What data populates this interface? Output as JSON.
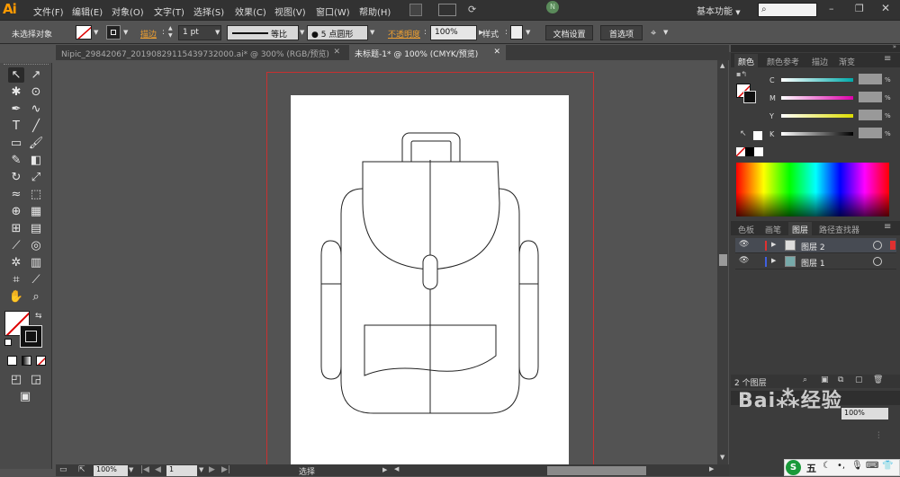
{
  "app": {
    "logo": "Ai",
    "workspace": "基本功能"
  },
  "menu": [
    "文件(F)",
    "编辑(E)",
    "对象(O)",
    "文字(T)",
    "选择(S)",
    "效果(C)",
    "视图(V)",
    "窗口(W)",
    "帮助(H)"
  ],
  "control": {
    "selection_label": "未选择对象",
    "stroke_label": "描边",
    "stroke_value": "1 pt",
    "profile_label": "等比",
    "brush_label": "5 点圆形",
    "opacity_label": "不透明度",
    "opacity_value": "100%",
    "style_label": "样式",
    "doc_setup": "文档设置",
    "prefs": "首选项"
  },
  "tabs": [
    {
      "label": "Nipic_29842067_20190829115439732000.ai* @ 300% (RGB/预览)",
      "active": false
    },
    {
      "label": "未标题-1* @ 100% (CMYK/预览)",
      "active": true
    }
  ],
  "status": {
    "zoom": "100%",
    "page": "1",
    "tool": "选择"
  },
  "color_panel": {
    "tabs": [
      "颜色",
      "颜色参考",
      "描边",
      "渐变"
    ],
    "channels": [
      "C",
      "M",
      "Y",
      "K"
    ],
    "unit": "%"
  },
  "layers_panel": {
    "tabs": [
      "色板",
      "画笔",
      "图层",
      "路径查找器"
    ],
    "layers": [
      {
        "name": "图层 2",
        "color": "#e03030"
      },
      {
        "name": "图层 1",
        "color": "#4060e0"
      }
    ],
    "count": "2 个图层"
  },
  "bottom_panel": {
    "opacity_value": "100%"
  },
  "taskbar": {
    "ime": "五"
  },
  "watermark": "Baidu 经验",
  "colors": {
    "accent": "#f0a030",
    "artboard_border": "#c83030"
  }
}
